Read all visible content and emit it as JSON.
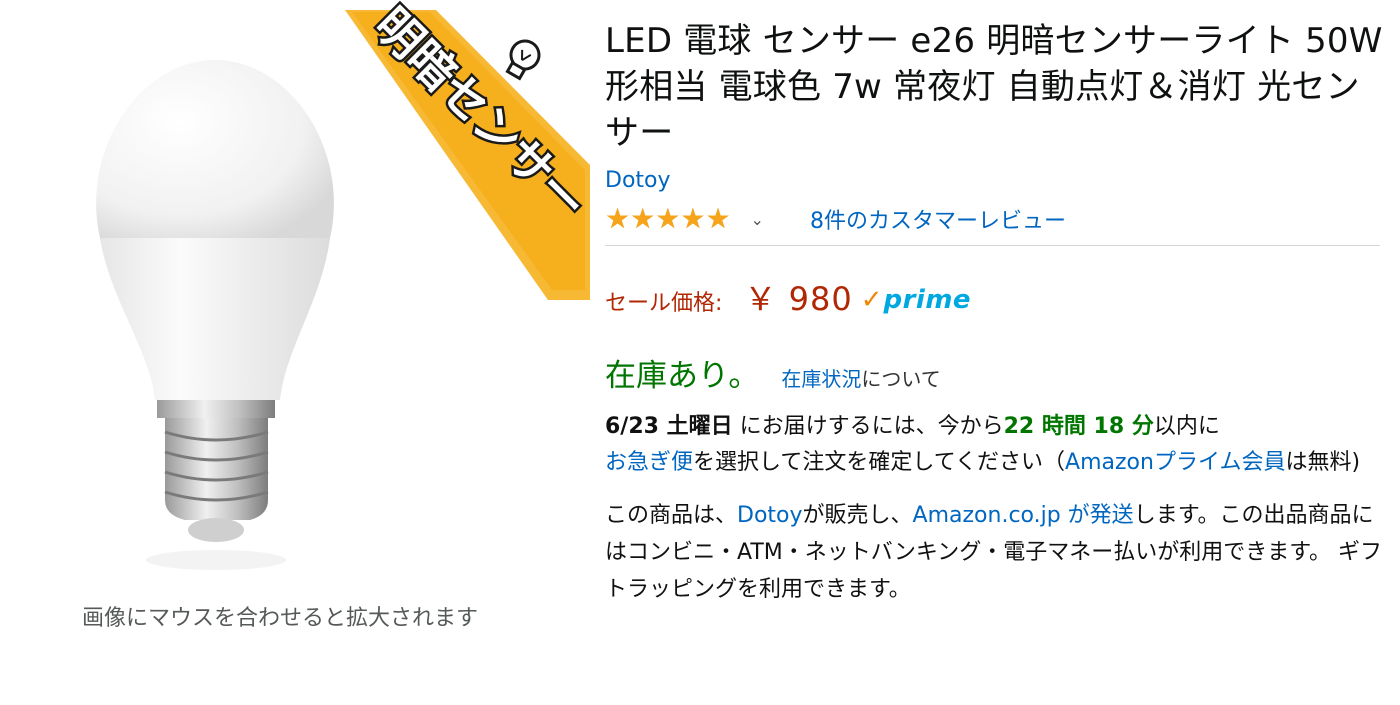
{
  "image": {
    "badge_text": "明暗センサー",
    "caption": "画像にマウスを合わせると拡大されます"
  },
  "product": {
    "title": "LED 電球 センサー e26 明暗センサーライト 50W形相当 電球色 7w 常夜灯 自動点灯＆消灯 光センサー",
    "brand": "Dotoy",
    "rating_stars": 5,
    "reviews_label": "8件のカスタマーレビュー",
    "price_label": "セール価格:",
    "price": "￥ 980",
    "prime_label": "prime",
    "stock": "在庫あり。",
    "stock_link": "在庫状況",
    "stock_suffix": "について"
  },
  "delivery": {
    "date": "6/23 土曜日",
    "text1": " にお届けするには、今から",
    "countdown": "22 時間 18 分",
    "text2": "以内に",
    "service": "お急ぎ便",
    "text3": "を選択して注文を確定してください（",
    "prime_members": "Amazonプライム会員",
    "text4": "は無料)"
  },
  "seller": {
    "text1": "この商品は、",
    "seller_name": "Dotoy",
    "text2": "が販売し、",
    "fulfiller": "Amazon.co.jp が発送",
    "text3": "します。この出品商品にはコンビニ・ATM・ネットバンキング・電子マネー払いが利用できます。 ギフトラッピングを利用できます。"
  },
  "colors": {
    "accent_link": "#0066c0",
    "price": "#b12704",
    "stock": "#007600",
    "star": "#f7a41d",
    "prime": "#00a8e1",
    "badge": "#f6b01e"
  },
  "icons": [
    "star-icon",
    "chevron-down-icon",
    "prime-check-icon",
    "lightbulb-icon"
  ]
}
